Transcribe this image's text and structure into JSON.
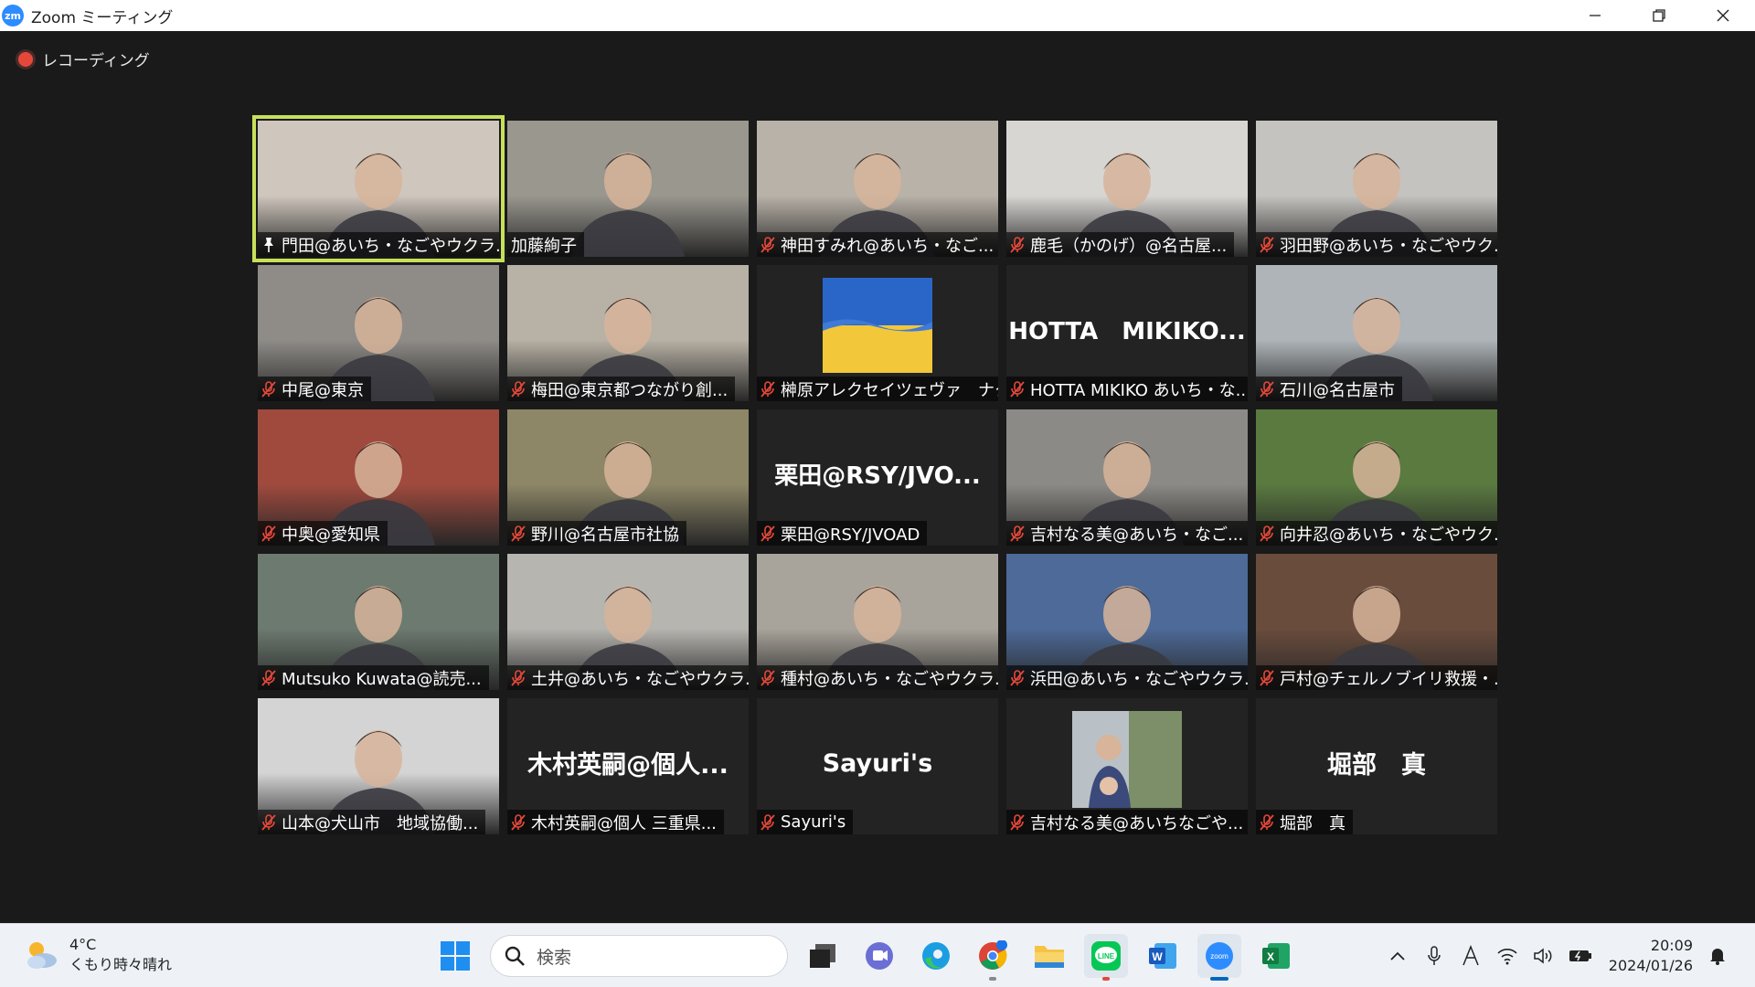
{
  "window": {
    "title": "Zoom ミーティング",
    "logo_text": "zm"
  },
  "recording": {
    "label": "レコーディング"
  },
  "participants": [
    {
      "name": "門田@あいち・なごやウクラ...",
      "video": true,
      "active": true,
      "pinned": true,
      "muted": false,
      "bg": "#cfc6bd"
    },
    {
      "name": "加藤絢子",
      "video": true,
      "active": false,
      "muted": false,
      "bg": "#9a978f"
    },
    {
      "name": "神田すみれ@あいち・なご...",
      "video": true,
      "muted": true,
      "bg": "#b9b2a8"
    },
    {
      "name": "鹿毛（かのげ）@名古屋...",
      "video": true,
      "muted": true,
      "bg": "#d8d6d3"
    },
    {
      "name": "羽田野@あいち・なごやウク...",
      "video": true,
      "muted": true,
      "bg": "#c5c3bf"
    },
    {
      "name": "中尾@東京",
      "video": true,
      "muted": true,
      "bg": "#8f8c88"
    },
    {
      "name": "梅田@東京都つながり創...",
      "video": true,
      "muted": true,
      "bg": "#b8b1a5"
    },
    {
      "name": "榊原アレクセイツェヴァ　ナタ...",
      "video": false,
      "muted": true,
      "avatar": "ukraine-flag"
    },
    {
      "name": "HOTTA MIKIKO あいち・な...",
      "video": false,
      "muted": true,
      "big_text": "HOTTA　MIKIKO..."
    },
    {
      "name": "石川@名古屋市",
      "video": true,
      "muted": true,
      "bg": "#aeb4b8"
    },
    {
      "name": "中奥@愛知県",
      "video": true,
      "muted": true,
      "bg": "#a04a3e"
    },
    {
      "name": "野川@名古屋市社協",
      "video": true,
      "muted": true,
      "bg": "#8d8767"
    },
    {
      "name": "栗田@RSY/JVOAD",
      "video": false,
      "muted": true,
      "big_text": "栗田@RSY/JVO..."
    },
    {
      "name": "吉村なる美@あいち・なご...",
      "video": true,
      "muted": true,
      "bg": "#8c8a86"
    },
    {
      "name": "向井忍@あいち・なごやウク...",
      "video": true,
      "muted": true,
      "bg": "#5a7a40"
    },
    {
      "name": "Mutsuko Kuwata@読売...",
      "video": true,
      "muted": true,
      "bg": "#6d7a70"
    },
    {
      "name": "土井@あいち・なごやウクラ...",
      "video": true,
      "muted": true,
      "bg": "#b6b5b0"
    },
    {
      "name": "種村@あいち・なごやウクラ...",
      "video": true,
      "muted": true,
      "bg": "#a9a49b"
    },
    {
      "name": "浜田@あいち・なごやウクラ...",
      "video": true,
      "muted": true,
      "bg": "#4d6a98"
    },
    {
      "name": "戸村@チェルノブイリ救援・...",
      "video": true,
      "muted": true,
      "bg": "#6a4c3c"
    },
    {
      "name": "山本@犬山市　地域協働...",
      "video": true,
      "muted": true,
      "bg": "#d4d4d4"
    },
    {
      "name": "木村英嗣@個人 三重県...",
      "video": false,
      "muted": true,
      "big_text": "木村英嗣@個人..."
    },
    {
      "name": "Sayuri's",
      "video": false,
      "muted": true,
      "big_text": "Sayuri's"
    },
    {
      "name": "吉村なる美@あいちなごや...",
      "video": false,
      "muted": true,
      "avatar": "photo"
    },
    {
      "name": "堀部　真",
      "video": false,
      "muted": true,
      "big_text": "堀部　真"
    }
  ],
  "taskbar": {
    "weather_temp": "4°C",
    "weather_desc": "くもり時々晴れ",
    "search_placeholder": "検索",
    "time": "20:09",
    "date": "2024/01/26",
    "apps": [
      "start",
      "search",
      "task-view",
      "teams",
      "edge",
      "chrome",
      "explorer",
      "line",
      "word",
      "zoom",
      "excel"
    ]
  },
  "colors": {
    "accent_active": "#c7e05a",
    "mic_muted": "#e5483a",
    "zoom_blue": "#2d8cff"
  }
}
